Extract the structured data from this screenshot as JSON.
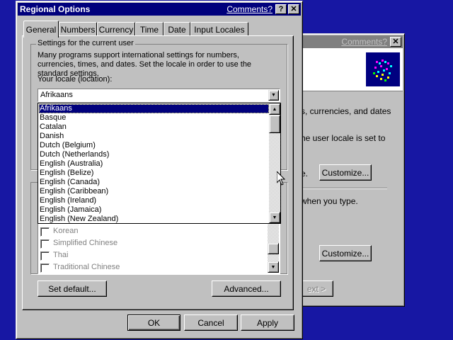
{
  "back_window": {
    "comments_link": "Comments?",
    "close_glyph": "✕",
    "text1": "s, currencies, and dates",
    "text2": "he user locale is set to",
    "text3": "e.",
    "customize1": "Customize...",
    "text4": "when you type.",
    "customize2": "Customize...",
    "next_button": "ext >"
  },
  "dialog": {
    "title": "Regional Options",
    "comments_link": "Comments?",
    "help_glyph": "?",
    "close_glyph": "✕",
    "tabs": [
      "General",
      "Numbers",
      "Currency",
      "Time",
      "Date",
      "Input Locales"
    ],
    "group_label": "Settings for the current user",
    "description": "Many programs support international settings for numbers, currencies, times, and dates. Set the locale in order to use the standard settings.",
    "locale_label": "Your locale (location):",
    "locale_value": "Afrikaans",
    "dropdown_items": [
      "Afrikaans",
      "Basque",
      "Catalan",
      "Danish",
      "Dutch (Belgium)",
      "Dutch (Netherlands)",
      "English (Australia)",
      "English (Belize)",
      "English (Canada)",
      "English (Caribbean)",
      "English (Ireland)",
      "English (Jamaica)",
      "English (New Zealand)"
    ],
    "language_items": [
      "Korean",
      "Simplified Chinese",
      "Thai",
      "Traditional Chinese"
    ],
    "set_default": "Set default...",
    "advanced": "Advanced...",
    "ok": "OK",
    "cancel": "Cancel",
    "apply": "Apply"
  }
}
